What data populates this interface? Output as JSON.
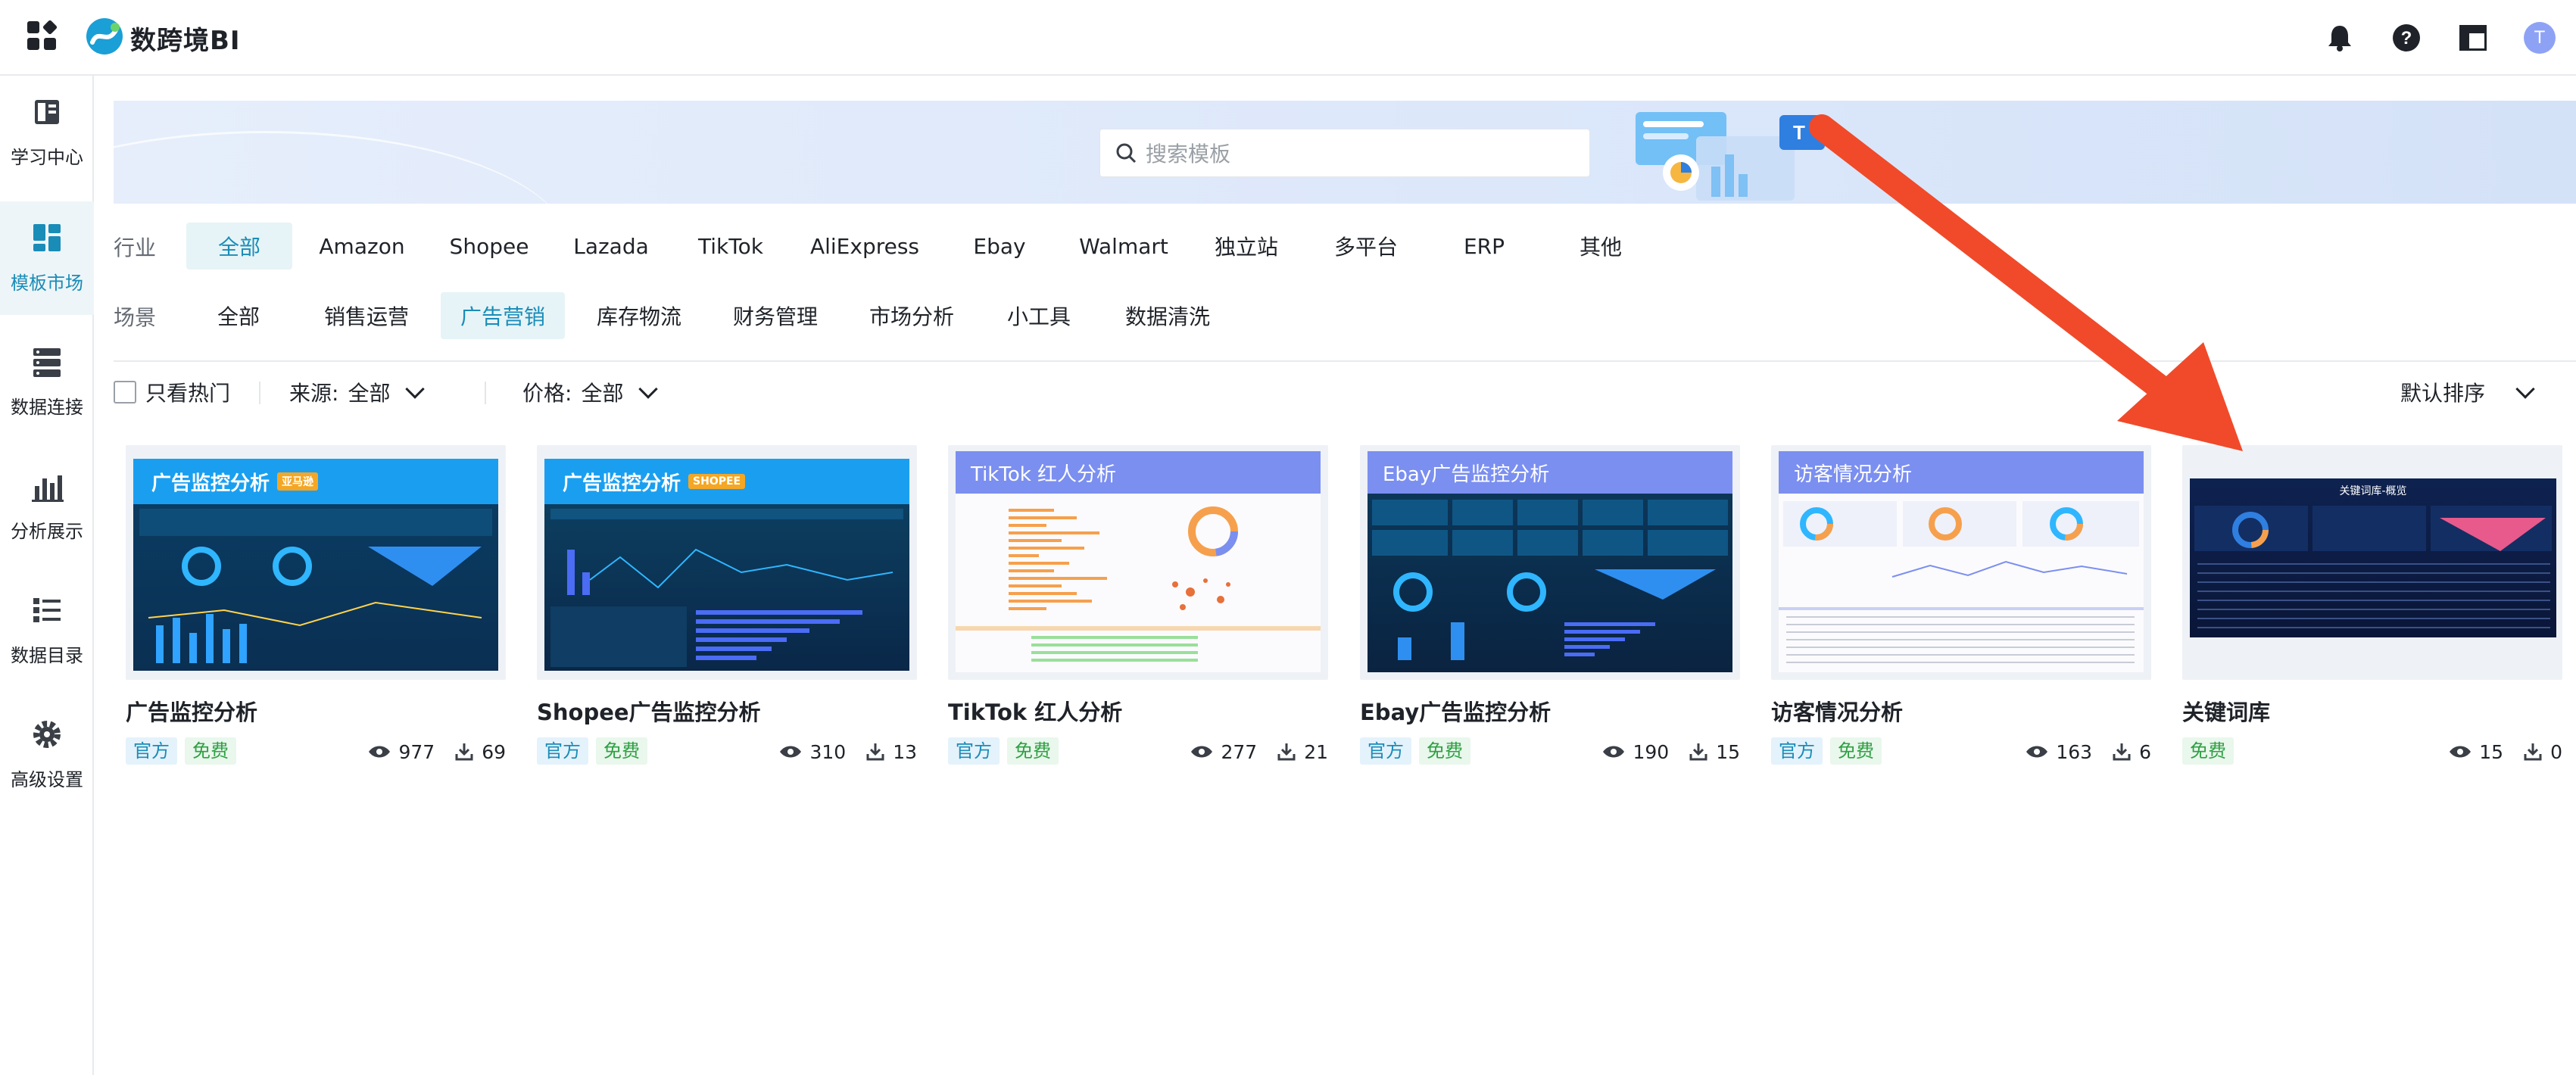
{
  "app": {
    "brand": "数跨境BI",
    "avatar_letter": "T"
  },
  "sidebar": {
    "items": [
      {
        "label": "学习中心",
        "icon": "book-icon",
        "active": false
      },
      {
        "label": "模板市场",
        "icon": "template-grid-icon",
        "active": true
      },
      {
        "label": "数据连接",
        "icon": "data-connect-icon",
        "active": false
      },
      {
        "label": "分析展示",
        "icon": "bar-analysis-icon",
        "active": false
      },
      {
        "label": "数据目录",
        "icon": "catalog-list-icon",
        "active": false
      },
      {
        "label": "高级设置",
        "icon": "gear-icon",
        "active": false
      }
    ]
  },
  "search": {
    "placeholder": "搜索模板"
  },
  "filters": {
    "industry_label": "行业",
    "industry": [
      "全部",
      "Amazon",
      "Shopee",
      "Lazada",
      "TikTok",
      "AliExpress",
      "Ebay",
      "Walmart",
      "独立站",
      "多平台",
      "ERP",
      "其他"
    ],
    "industry_selected": "全部",
    "scene_label": "场景",
    "scene": [
      "全部",
      "销售运营",
      "广告营销",
      "库存物流",
      "财务管理",
      "市场分析",
      "小工具",
      "数据清洗"
    ],
    "scene_selected": "广告营销"
  },
  "options": {
    "hot_only": "只看热门",
    "source_label": "来源:",
    "source_value": "全部",
    "price_label": "价格:",
    "price_value": "全部",
    "sort": "默认排序"
  },
  "cards": [
    {
      "thumb_title": "广告监控分析",
      "thumb_badge": "亚马逊",
      "title": "广告监控分析",
      "official": "官方",
      "free": "免费",
      "views": "977",
      "downloads": "69"
    },
    {
      "thumb_title": "广告监控分析",
      "thumb_badge": "SHOPEE",
      "title": "Shopee广告监控分析",
      "official": "官方",
      "free": "免费",
      "views": "310",
      "downloads": "13"
    },
    {
      "thumb_title": "TikTok 红人分析",
      "title": "TikTok 红人分析",
      "official": "官方",
      "free": "免费",
      "views": "277",
      "downloads": "21"
    },
    {
      "thumb_title": "Ebay广告监控分析",
      "title": "Ebay广告监控分析",
      "official": "官方",
      "free": "免费",
      "views": "190",
      "downloads": "15"
    },
    {
      "thumb_title": "访客情况分析",
      "title": "访客情况分析",
      "official": "官方",
      "free": "免费",
      "views": "163",
      "downloads": "6"
    },
    {
      "thumb_title": "关键词库-概览",
      "title": "关键词库",
      "free": "免费",
      "views": "15",
      "downloads": "0"
    }
  ],
  "colors": {
    "accent": "#1a8cb8",
    "arrow": "#f04a2a",
    "dashboard_blue": "#1a9ff0",
    "dashboard_periwinkle": "#7b8ff0"
  }
}
